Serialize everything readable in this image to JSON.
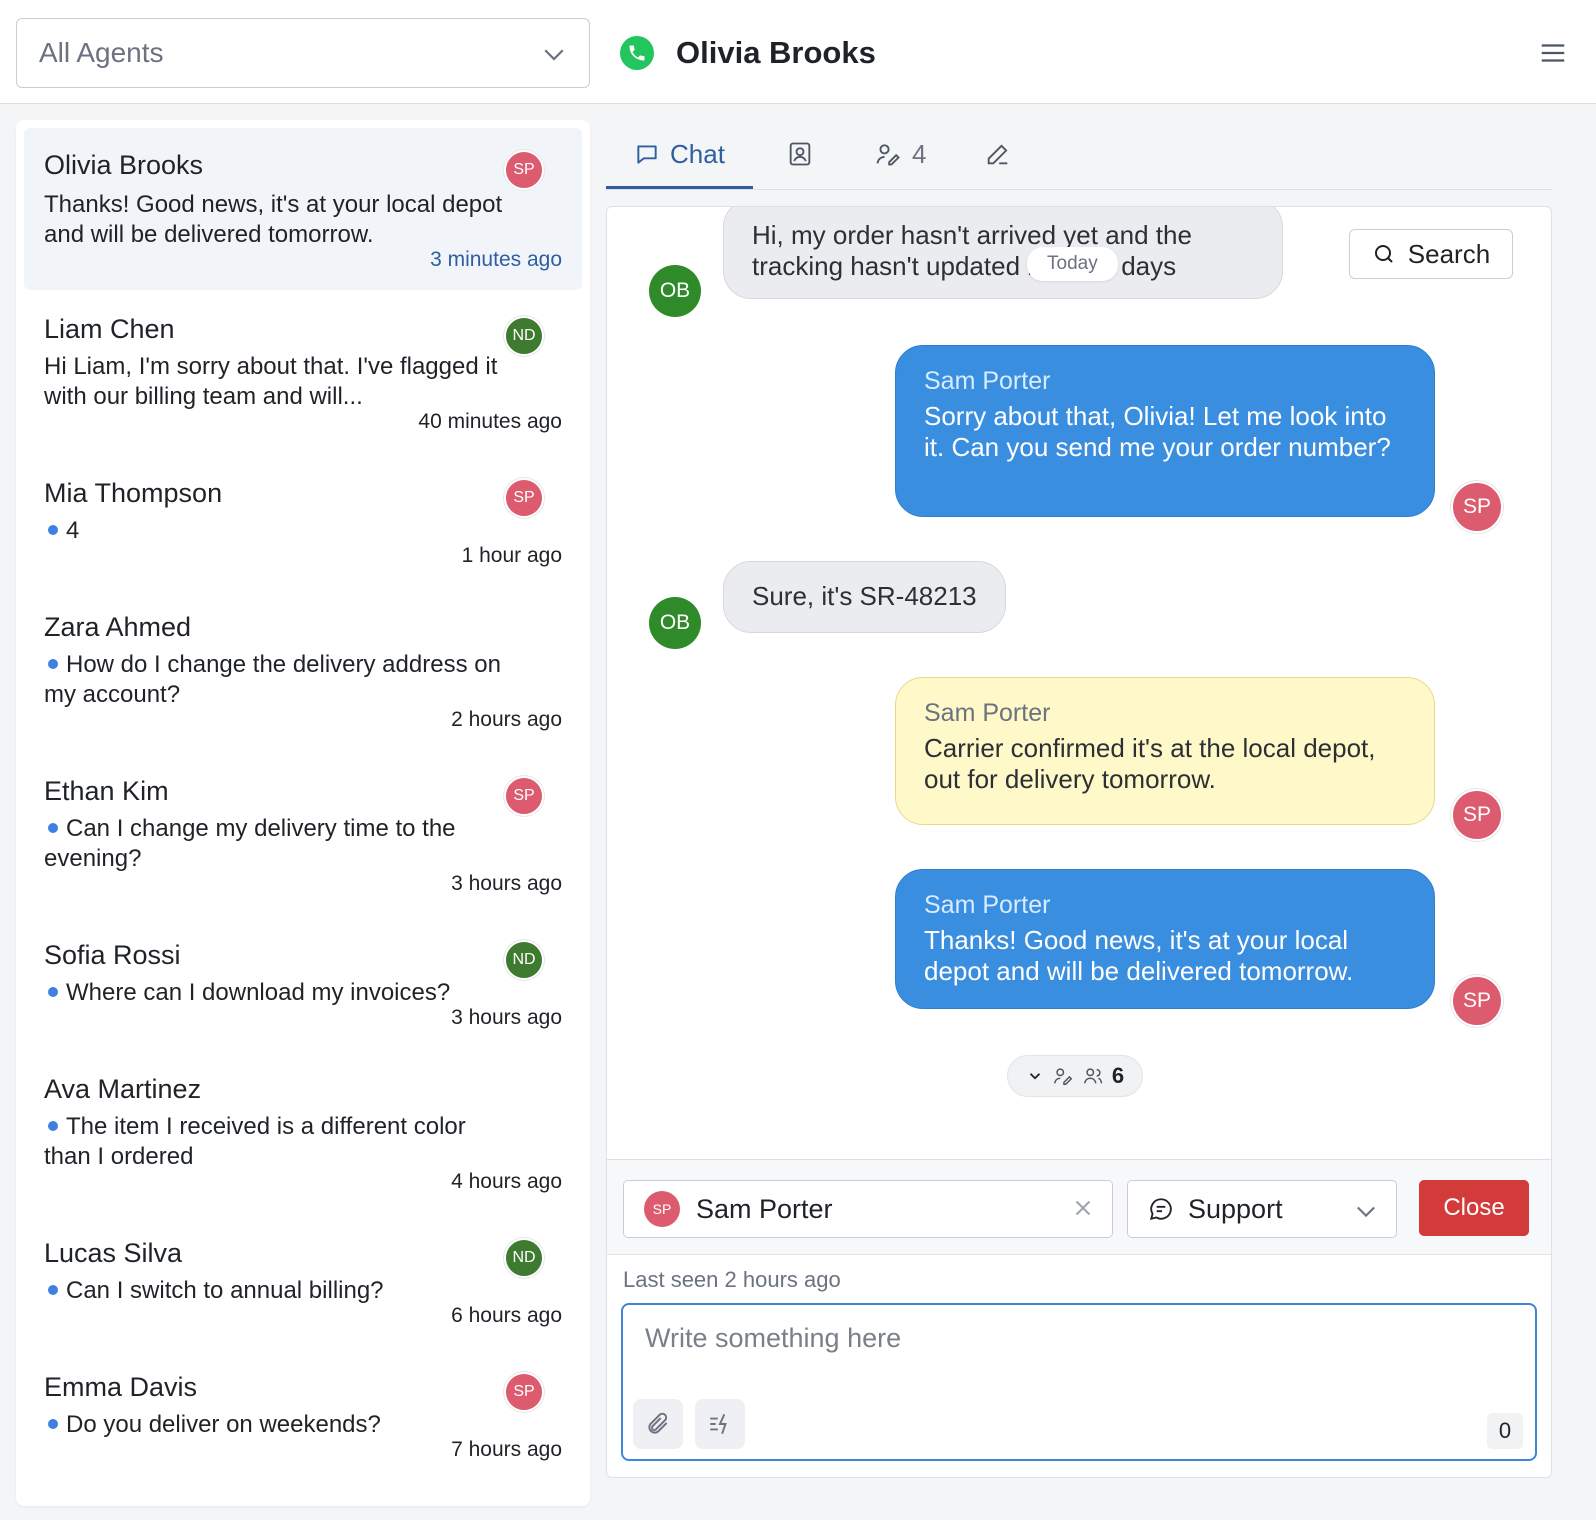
{
  "header": {
    "agent_filter": "All Agents",
    "contact_name": "Olivia Brooks"
  },
  "conversations": [
    {
      "name": "Olivia Brooks",
      "message": "Thanks! Good news, it's at your local depot and will be delivered tomorrow.",
      "time": "3 minutes ago",
      "agent": "SP",
      "unread_dot": false
    },
    {
      "name": "Liam Chen",
      "message": "Hi Liam, I'm sorry about that. I've flagged it with our billing team and will...",
      "time": "40 minutes ago",
      "agent": "ND",
      "unread_dot": false
    },
    {
      "name": "Mia Thompson",
      "message": "4",
      "time": "1 hour ago",
      "agent": "SP",
      "unread_dot": true
    },
    {
      "name": "Zara Ahmed",
      "message": "How do I change the delivery address on my account?",
      "time": "2 hours ago",
      "agent": "",
      "unread_dot": true
    },
    {
      "name": "Ethan Kim",
      "message": "Can I change my delivery time to the evening?",
      "time": "3 hours ago",
      "agent": "SP",
      "unread_dot": true
    },
    {
      "name": "Sofia Rossi",
      "message": "Where can I download my invoices?",
      "time": "3 hours ago",
      "agent": "ND",
      "unread_dot": true
    },
    {
      "name": "Ava Martinez",
      "message": "The item I received is a different color than I ordered",
      "time": "4 hours ago",
      "agent": "",
      "unread_dot": true
    },
    {
      "name": "Lucas Silva",
      "message": "Can I switch to annual billing?",
      "time": "6 hours ago",
      "agent": "ND",
      "unread_dot": true
    },
    {
      "name": "Emma Davis",
      "message": "Do you deliver on weekends?",
      "time": "7 hours ago",
      "agent": "SP",
      "unread_dot": true
    }
  ],
  "tabs": {
    "chat": "Chat",
    "participants_count": "4"
  },
  "chat": {
    "today_label": "Today",
    "search_label": "Search",
    "messages": [
      {
        "type": "incoming",
        "avatar": "OB",
        "text": "Hi, my order hasn't arrived yet and the tracking hasn't updated in three days"
      },
      {
        "type": "outgoing",
        "avatar": "SP",
        "sender": "Sam Porter",
        "text": "Sorry about that, Olivia! Let me look into it. Can you send me your order number?"
      },
      {
        "type": "incoming",
        "avatar": "OB",
        "text": "Sure, it's SR-48213"
      },
      {
        "type": "note",
        "avatar": "SP",
        "sender": "Sam Porter",
        "text": "Carrier confirmed it's at the local depot, out for delivery tomorrow."
      },
      {
        "type": "outgoing",
        "avatar": "SP",
        "sender": "Sam Porter",
        "text": "Thanks! Good news, it's at your local depot and will be delivered tomorrow."
      }
    ],
    "collapsed_count": "6"
  },
  "compose": {
    "assignee": "Sam Porter",
    "assignee_initials": "SP",
    "inbox": "Support",
    "close_label": "Close",
    "last_seen": "Last seen 2 hours ago",
    "placeholder": "Write something here",
    "char_count": "0"
  },
  "colors": {
    "primary": "#2f5fa0",
    "outgoing_bubble": "#3a8ee0",
    "note_bubble": "#fff9c9",
    "close_button": "#d33a3a",
    "agent_sp": "#dc5b6e",
    "agent_nd": "#3e7a2f",
    "contact_ob": "#2f8a2a"
  },
  "icons": [
    "chevron-down-icon",
    "phone-icon",
    "menu-icon",
    "chat-icon",
    "contact-card-icon",
    "participants-icon",
    "edit-icon",
    "search-icon",
    "clear-icon",
    "support-icon",
    "paperclip-icon",
    "quick-reply-icon"
  ]
}
